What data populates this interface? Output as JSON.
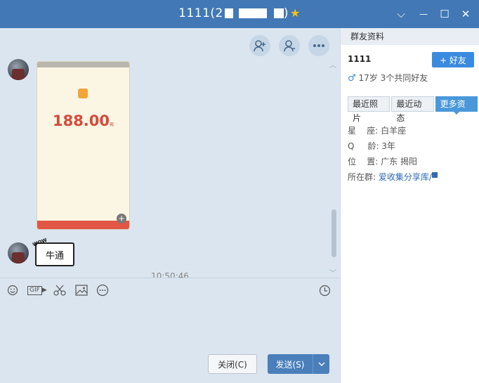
{
  "window": {
    "title": "1111(2",
    "title_end": ")",
    "minimize_label": "—",
    "maximize_label": "☐",
    "close_label": "✕",
    "menu_label": "⌵"
  },
  "chat": {
    "screenshot": {
      "amount": "188.00",
      "amount_unit": "元"
    },
    "sticker_text": "牛通",
    "sticker_badge": "WOW",
    "timestamp": "10:50:46"
  },
  "composer": {
    "gif_label": "GIF",
    "close_button": "关闭(C)",
    "send_button": "发送(S)"
  },
  "panel": {
    "header": "群友资料",
    "name": "1111",
    "add_friend": "+ 好友",
    "info": "17岁  3个共同好友",
    "tabs": [
      {
        "label": "最近照片"
      },
      {
        "label": "最近动态"
      },
      {
        "label": "更多资料"
      }
    ],
    "fields": [
      {
        "key": "星    座:",
        "value": "白羊座"
      },
      {
        "key": "Q     龄:",
        "value": "3年"
      },
      {
        "key": "位    置:",
        "value": "广东 揭阳"
      },
      {
        "key": "所在群:",
        "value": "爱收集分享库/"
      }
    ]
  },
  "colors": {
    "titlebar": "#4178b5",
    "chat_bg": "#dbe5ef",
    "accent": "#4a98da"
  }
}
